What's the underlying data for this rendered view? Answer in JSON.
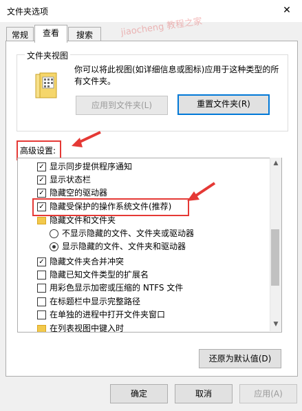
{
  "window": {
    "title": "文件夹选项",
    "close_icon": "✕"
  },
  "watermark": "jiaocheng 教程之家",
  "tabs": [
    {
      "label": "常规"
    },
    {
      "label": "查看"
    },
    {
      "label": "搜索"
    }
  ],
  "folder_views": {
    "label": "文件夹视图",
    "description": "你可以将此视图(如详细信息或图标)应用于这种类型的所有文件夹。",
    "apply_button": "应用到文件夹(L)",
    "reset_button": "重置文件夹(R)"
  },
  "advanced": {
    "label": "高级设置:",
    "items": [
      {
        "type": "checkbox",
        "checked": true,
        "label": "显示同步提供程序通知"
      },
      {
        "type": "checkbox",
        "checked": true,
        "label": "显示状态栏"
      },
      {
        "type": "checkbox",
        "checked": true,
        "label": "隐藏空的驱动器"
      },
      {
        "type": "checkbox",
        "checked": true,
        "label": "隐藏受保护的操作系统文件(推荐)"
      },
      {
        "type": "folder",
        "label": "隐藏文件和文件夹"
      },
      {
        "type": "radio",
        "checked": false,
        "label": "不显示隐藏的文件、文件夹或驱动器"
      },
      {
        "type": "radio",
        "checked": true,
        "label": "显示隐藏的文件、文件夹和驱动器"
      },
      {
        "type": "checkbox",
        "checked": true,
        "label": "隐藏文件夹合并冲突"
      },
      {
        "type": "checkbox",
        "checked": false,
        "label": "隐藏已知文件类型的扩展名"
      },
      {
        "type": "checkbox",
        "checked": false,
        "label": "用彩色显示加密或压缩的 NTFS 文件"
      },
      {
        "type": "checkbox",
        "checked": false,
        "label": "在标题栏中显示完整路径"
      },
      {
        "type": "checkbox",
        "checked": false,
        "label": "在单独的进程中打开文件夹窗口"
      },
      {
        "type": "folder",
        "label": "在列表视图中键入时"
      }
    ],
    "restore_button": "还原为默认值(D)"
  },
  "footer": {
    "ok": "确定",
    "cancel": "取消",
    "apply": "应用(A)"
  },
  "colors": {
    "highlight": "#e53935",
    "focus": "#0078d7"
  }
}
